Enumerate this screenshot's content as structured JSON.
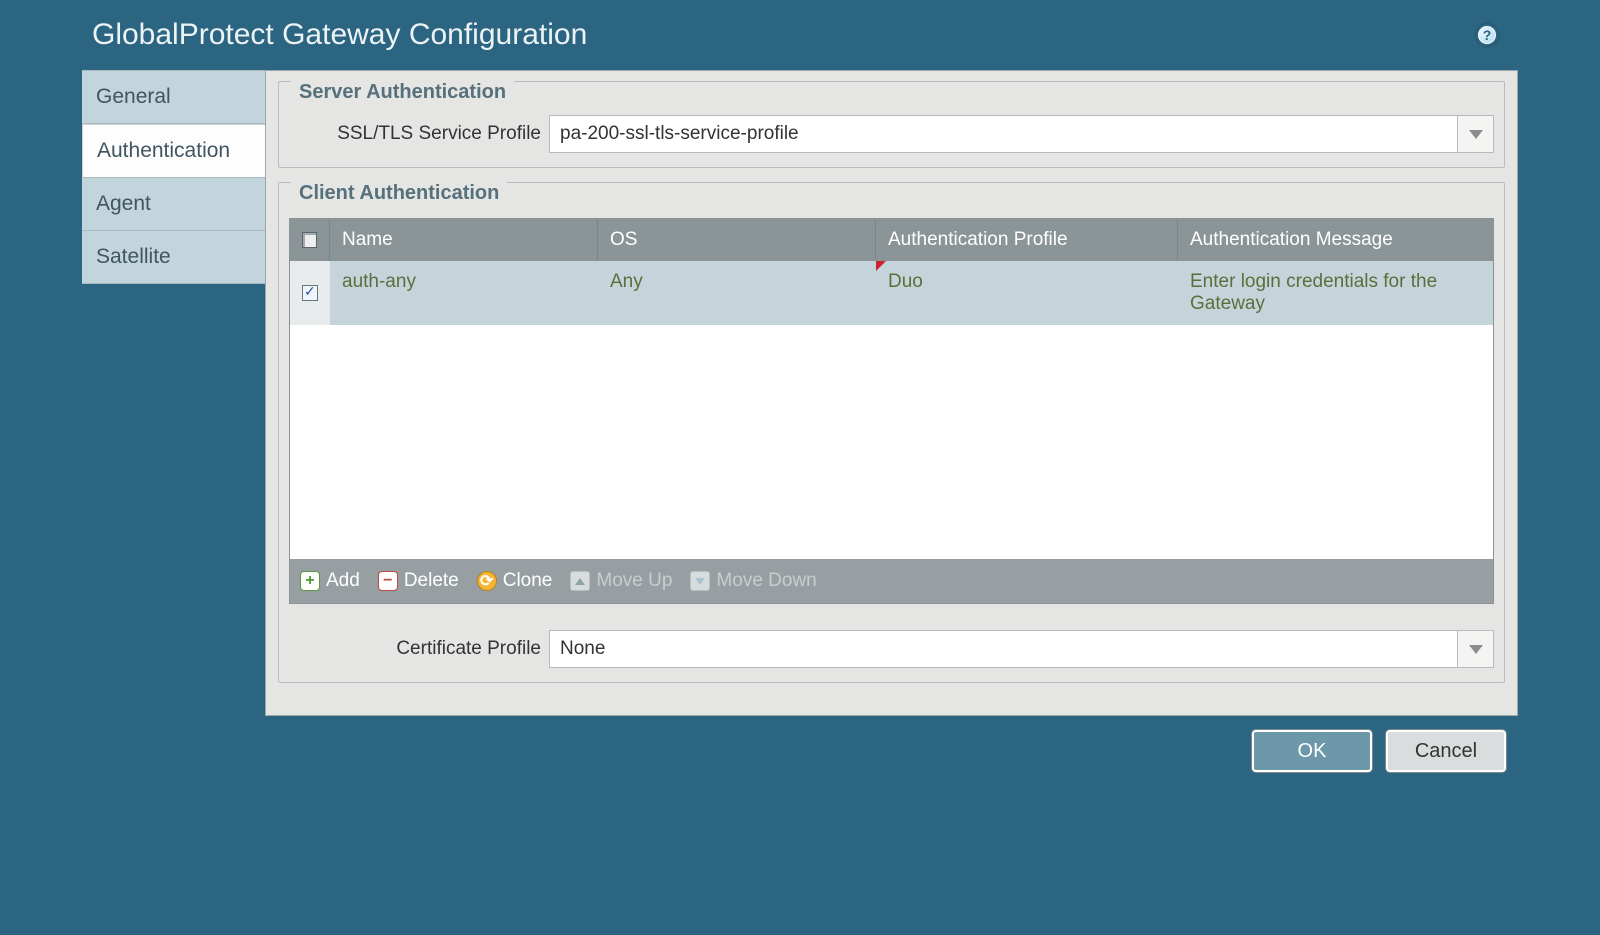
{
  "dialog": {
    "title": "GlobalProtect Gateway Configuration"
  },
  "tabs": [
    "General",
    "Authentication",
    "Agent",
    "Satellite"
  ],
  "activeTab": "Authentication",
  "serverAuth": {
    "legend": "Server Authentication",
    "sslLabel": "SSL/TLS Service Profile",
    "sslValue": "pa-200-ssl-tls-service-profile"
  },
  "clientAuth": {
    "legend": "Client Authentication",
    "columns": {
      "name": "Name",
      "os": "OS",
      "authProfile": "Authentication Profile",
      "authMessage": "Authentication Message"
    },
    "rows": [
      {
        "checked": true,
        "name": "auth-any",
        "os": "Any",
        "authProfile": "Duo",
        "authMessage": "Enter login credentials for the Gateway"
      }
    ],
    "toolbar": {
      "add": "Add",
      "delete": "Delete",
      "clone": "Clone",
      "moveUp": "Move Up",
      "moveDown": "Move Down"
    }
  },
  "certProfile": {
    "label": "Certificate Profile",
    "value": "None"
  },
  "buttons": {
    "ok": "OK",
    "cancel": "Cancel"
  }
}
